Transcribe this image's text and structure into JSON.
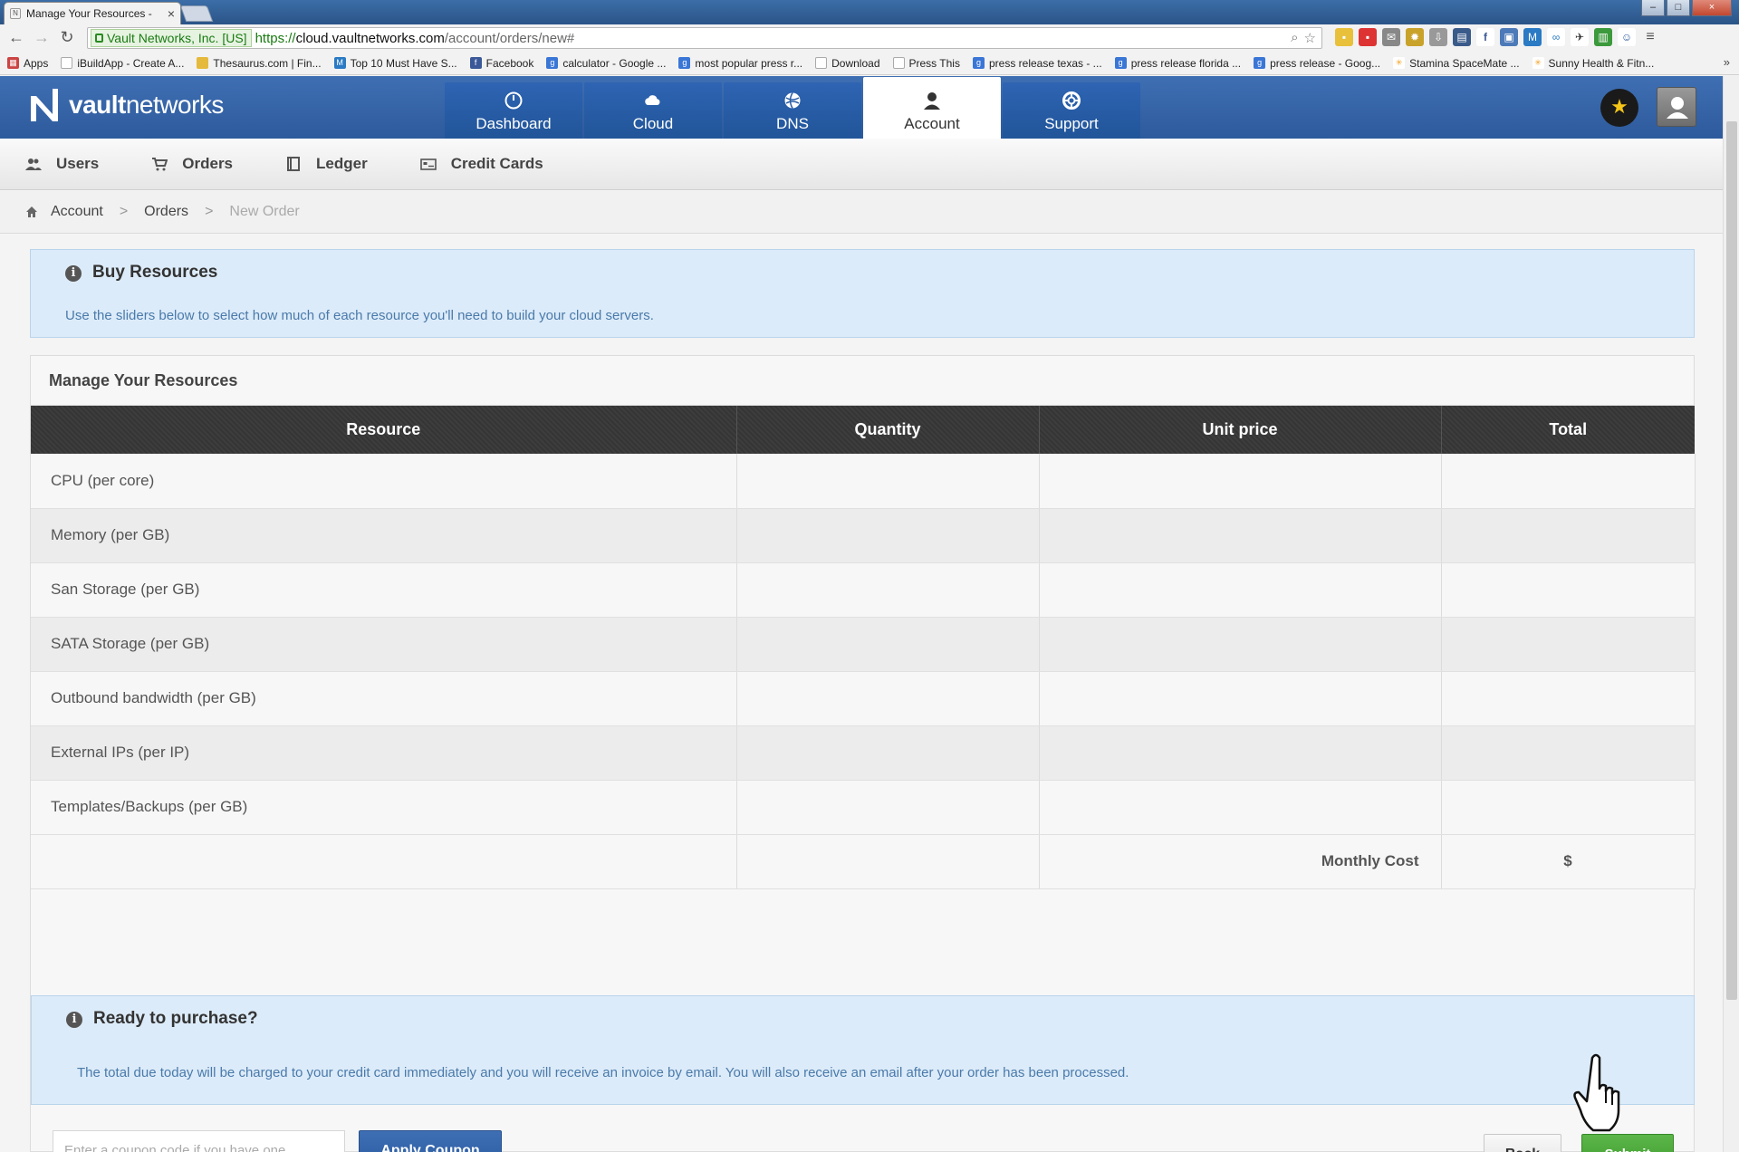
{
  "browser": {
    "tab_title": "Manage Your Resources -",
    "tab_close": "×",
    "ev_label": "Vault Networks, Inc. [US]",
    "url_scheme": "https://",
    "url_host": "cloud.vaultnetworks.com",
    "url_path": "/account/orders/new#",
    "bookmarks": [
      {
        "label": "Apps"
      },
      {
        "label": "iBuildApp - Create A..."
      },
      {
        "label": "Thesaurus.com | Fin..."
      },
      {
        "label": "Top 10 Must Have S..."
      },
      {
        "label": "Facebook"
      },
      {
        "label": "calculator - Google ..."
      },
      {
        "label": "most popular press r..."
      },
      {
        "label": "Download"
      },
      {
        "label": "Press This"
      },
      {
        "label": "press release texas - ..."
      },
      {
        "label": "press release florida ..."
      },
      {
        "label": "press release - Goog..."
      },
      {
        "label": "Stamina SpaceMate ..."
      },
      {
        "label": "Sunny Health & Fitn..."
      }
    ],
    "bookmarks_more": "»"
  },
  "brand": {
    "bold": "vault",
    "light": "networks"
  },
  "main_nav": [
    {
      "label": "Dashboard",
      "icon": "dashboard-icon"
    },
    {
      "label": "Cloud",
      "icon": "cloud-icon"
    },
    {
      "label": "DNS",
      "icon": "globe-icon"
    },
    {
      "label": "Account",
      "icon": "user-icon"
    },
    {
      "label": "Support",
      "icon": "lifebuoy-icon"
    }
  ],
  "sub_nav": [
    {
      "label": "Users",
      "icon": "users-icon"
    },
    {
      "label": "Orders",
      "icon": "cart-icon"
    },
    {
      "label": "Ledger",
      "icon": "ledger-icon"
    },
    {
      "label": "Credit Cards",
      "icon": "credit-card-icon"
    }
  ],
  "breadcrumb": {
    "items": [
      "Account",
      "Orders"
    ],
    "current": "New Order",
    "separator": ">"
  },
  "buy_alert": {
    "title": "Buy Resources",
    "text": "Use the sliders below to select how much of each resource you'll need to build your cloud servers."
  },
  "panel": {
    "title": "Manage Your Resources",
    "columns": [
      "Resource",
      "Quantity",
      "Unit price",
      "Total"
    ],
    "rows": [
      "CPU (per core)",
      "Memory (per GB)",
      "San Storage (per GB)",
      "SATA Storage (per GB)",
      "Outbound bandwidth (per GB)",
      "External IPs (per IP)",
      "Templates/Backups (per GB)"
    ],
    "monthly_cost_label": "Monthly Cost",
    "monthly_cost_value": "$"
  },
  "ready_alert": {
    "title": "Ready to purchase?",
    "text": "The total due today will be charged to your credit card immediately and you will receive an invoice by email. You will also receive an email after your order has been processed."
  },
  "coupon": {
    "placeholder": "Enter a coupon code if you have one...",
    "apply_label": "Apply Coupon"
  },
  "actions": {
    "back_label": "Back",
    "submit_label": "Submit"
  },
  "colors": {
    "header_blue": "#2d5a9c",
    "submit_green": "#4aa83a",
    "alert_bg": "#dcebf9"
  }
}
